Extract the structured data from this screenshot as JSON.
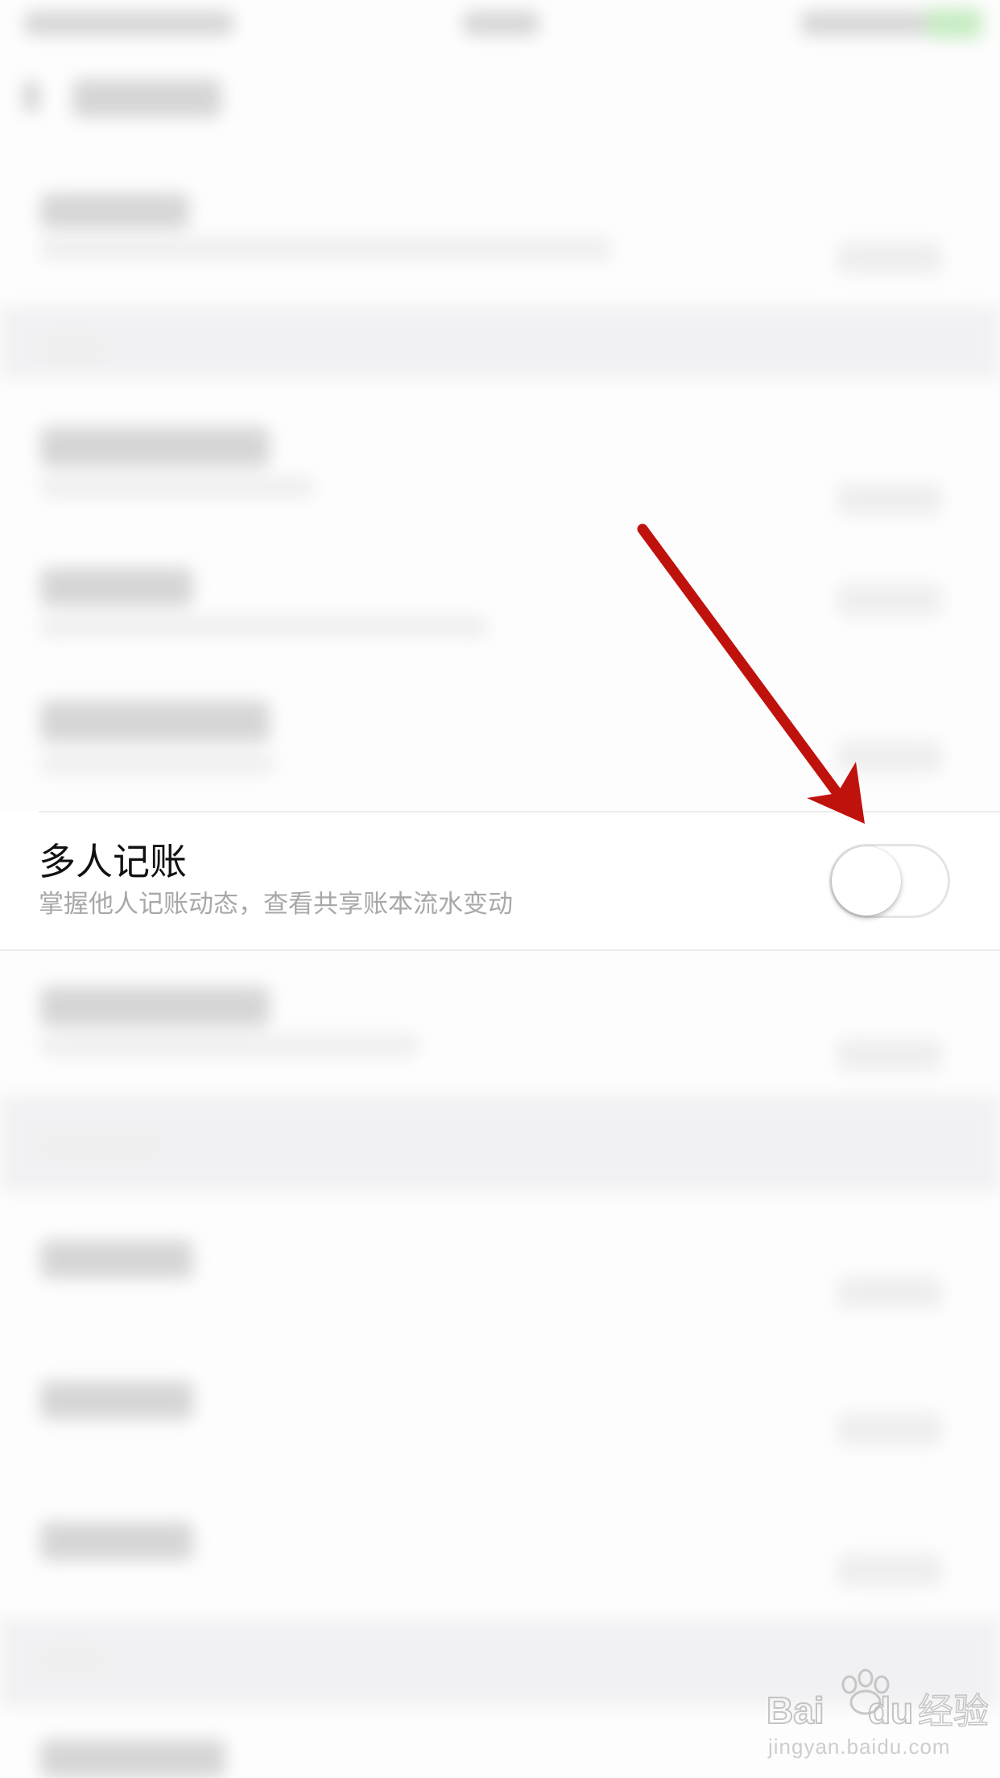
{
  "setting": {
    "title": "多人记账",
    "subtitle": "掌握他人记账动态，查看共享账本流水变动",
    "enabled": false
  },
  "watermark": {
    "brand": "Baidu经验",
    "url": "jingyan.baidu.com"
  },
  "colors": {
    "arrow": "#c0120c",
    "title_text": "#111111",
    "subtitle_text": "#a8a8a8",
    "toggle_track_off": "#ffffff"
  }
}
